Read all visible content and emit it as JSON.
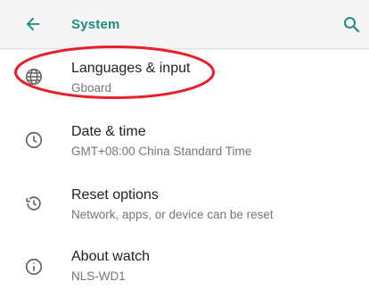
{
  "header": {
    "title": "System",
    "back_icon": "arrow-back-icon",
    "search_icon": "search-icon"
  },
  "colors": {
    "accent": "#1a8b7e",
    "annotation": "#e8202a",
    "primary_text": "#212121",
    "secondary_text": "#757575"
  },
  "settings": {
    "items": [
      {
        "title": "Languages & input",
        "summary": "Gboard",
        "icon": "globe-icon"
      },
      {
        "title": "Date & time",
        "summary": "GMT+08:00 China Standard Time",
        "icon": "clock-icon"
      },
      {
        "title": "Reset options",
        "summary": "Network, apps, or device can be reset",
        "icon": "history-icon"
      },
      {
        "title": "About watch",
        "summary": "NLS-WD1",
        "icon": "info-icon"
      }
    ]
  },
  "annotation": {
    "shape": "red-ellipse",
    "target": "Languages & input"
  }
}
